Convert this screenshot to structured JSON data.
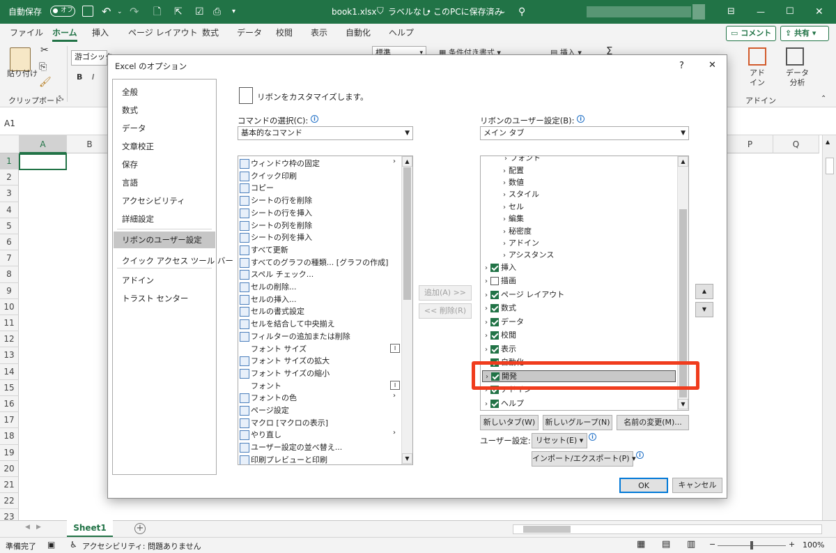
{
  "app": {
    "autosave_label": "自動保存",
    "autosave_state": "オフ",
    "file_title": "book1.xlsx",
    "label_status": "ラベルなし",
    "save_location": "このPCに保存済み",
    "save_location_sep": "•"
  },
  "menu": {
    "tabs": [
      "ファイル",
      "ホーム",
      "挿入",
      "ページ レイアウト",
      "数式",
      "データ",
      "校閲",
      "表示",
      "自動化",
      "ヘルプ"
    ],
    "comment_button": "コメント",
    "share_button": "共有"
  },
  "ribbon": {
    "paste_label": "貼り付け",
    "clipboard_group": "クリップボード",
    "font_name": "游ゴシック",
    "bold": "B",
    "italic": "I",
    "number_format": "標準",
    "conditional_format": "条件付き書式",
    "insert_label": "挿入",
    "sum_label": "Σ",
    "addin_label": "アド\nイン",
    "addin_group": "アドイン",
    "analyze_label": "データ\n分析"
  },
  "formula_bar": {
    "name_box": "A1"
  },
  "grid": {
    "columns": [
      "A",
      "B",
      "P",
      "Q"
    ],
    "rows": [
      "1",
      "2",
      "3",
      "4",
      "5",
      "6",
      "7",
      "8",
      "9",
      "10",
      "11",
      "12",
      "13",
      "14",
      "15",
      "16",
      "17",
      "18",
      "19",
      "20",
      "21",
      "22",
      "23"
    ]
  },
  "sheets": {
    "active": "Sheet1",
    "add": "+"
  },
  "status": {
    "ready": "準備完了",
    "accessibility": "アクセシビリティ: 問題ありません",
    "zoom": "100%",
    "minus": "−",
    "plus": "+"
  },
  "dialog": {
    "title": "Excel のオプション",
    "help": "?",
    "close": "✕",
    "nav": [
      "全般",
      "数式",
      "データ",
      "文章校正",
      "保存",
      "言語",
      "アクセシビリティ",
      "詳細設定",
      "リボンのユーザー設定",
      "クイック アクセス ツール バー",
      "アドイン",
      "トラスト センター"
    ],
    "heading": "リボンをカスタマイズします。",
    "commands_label": "コマンドの選択(C):",
    "commands_value": "基本的なコマンド",
    "ribbon_label": "リボンのユーザー設定(B):",
    "ribbon_value": "メイン タブ",
    "commands": [
      "ウィンドウ枠の固定",
      "クイック印刷",
      "コピー",
      "シートの行を削除",
      "シートの行を挿入",
      "シートの列を削除",
      "シートの列を挿入",
      "すべて更新",
      "すべてのグラフの種類... [グラフの作成]",
      "スペル チェック...",
      "セルの削除...",
      "セルの挿入...",
      "セルの書式設定",
      "セルを結合して中央揃え",
      "フィルターの追加または削除",
      "フォント サイズ",
      "フォント サイズの拡大",
      "フォント サイズの縮小",
      "フォント",
      "フォントの色",
      "ページ設定",
      "マクロ [マクロの表示]",
      "やり直し",
      "ユーザー設定の並べ替え...",
      "印刷プレビューと印刷"
    ],
    "add_button": "追加(A) >>",
    "remove_button": "<< 削除(R)",
    "tree_partial": "フォント",
    "tree_sub": [
      "配置",
      "数値",
      "スタイル",
      "セル",
      "編集",
      "秘密度",
      "アドイン",
      "アシスタンス"
    ],
    "tree_tabs": [
      {
        "label": "挿入",
        "checked": true
      },
      {
        "label": "描画",
        "checked": false
      },
      {
        "label": "ページ レイアウト",
        "checked": true
      },
      {
        "label": "数式",
        "checked": true
      },
      {
        "label": "データ",
        "checked": true
      },
      {
        "label": "校閲",
        "checked": true
      },
      {
        "label": "表示",
        "checked": true
      },
      {
        "label": "自動化",
        "checked": true
      },
      {
        "label": "開発",
        "checked": true
      },
      {
        "label": "アドイン",
        "checked": true
      },
      {
        "label": "ヘルプ",
        "checked": true
      }
    ],
    "new_tab": "新しいタブ(W)",
    "new_group": "新しいグループ(N)",
    "rename": "名前の変更(M)...",
    "user_settings_label": "ユーザー設定:",
    "reset": "リセット(E) ▾",
    "import_export": "インポート/エクスポート(P) ▾",
    "ok": "OK",
    "cancel": "キャンセル",
    "up": "▲",
    "down": "▼"
  }
}
